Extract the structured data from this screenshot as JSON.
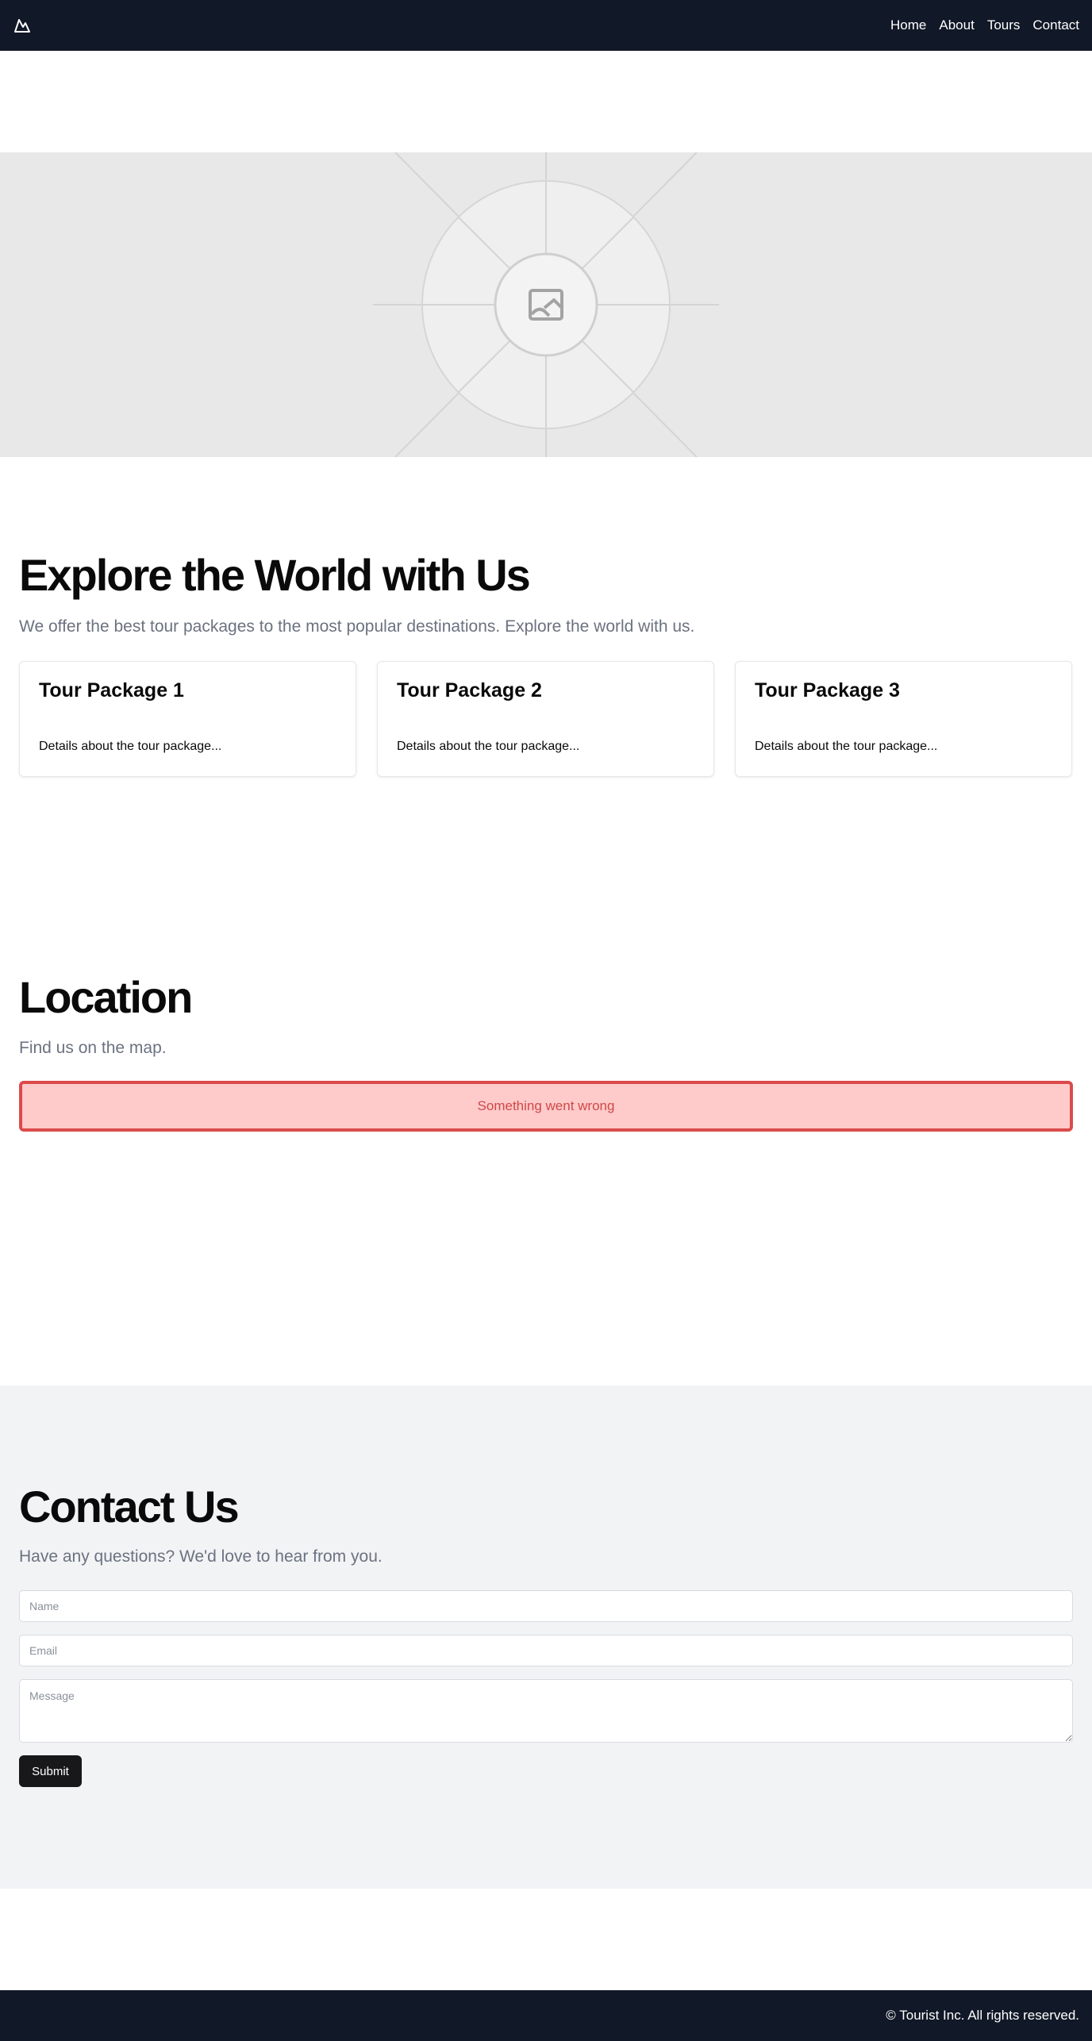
{
  "header": {
    "logo_icon": "mountain-icon",
    "nav": [
      "Home",
      "About",
      "Tours",
      "Contact"
    ]
  },
  "hero": {
    "icon": "image-placeholder-icon"
  },
  "explore": {
    "title": "Explore the World with Us",
    "subtitle": "We offer the best tour packages to the most popular destinations. Explore the world with us.",
    "cards": [
      {
        "title": "Tour Package 1",
        "body": "Details about the tour package..."
      },
      {
        "title": "Tour Package 2",
        "body": "Details about the tour package..."
      },
      {
        "title": "Tour Package 3",
        "body": "Details about the tour package..."
      }
    ]
  },
  "location": {
    "title": "Location",
    "subtitle": "Find us on the map.",
    "error": "Something went wrong"
  },
  "contact": {
    "title": "Contact Us",
    "subtitle": "Have any questions? We'd love to hear from you.",
    "name_placeholder": "Name",
    "email_placeholder": "Email",
    "message_placeholder": "Message",
    "submit_label": "Submit"
  },
  "footer": {
    "text": "© Tourist Inc. All rights reserved."
  },
  "colors": {
    "header_bg": "#111827",
    "error_bg": "#fecaca",
    "error_border": "#dc4a4a",
    "contact_bg": "#f2f3f5",
    "button_bg": "#18181b"
  }
}
